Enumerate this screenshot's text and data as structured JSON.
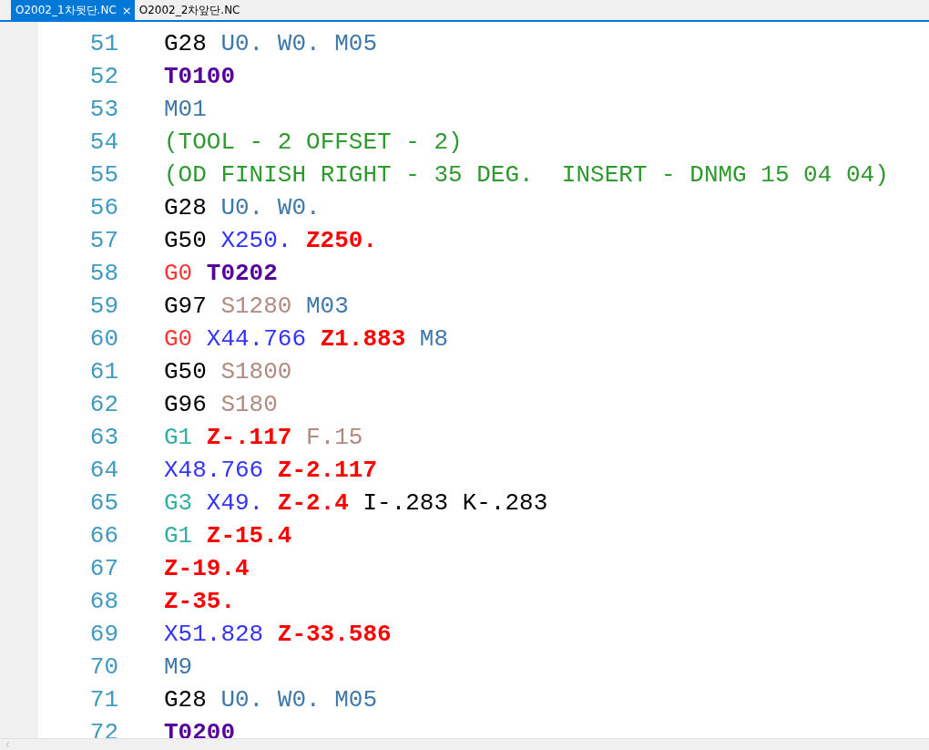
{
  "tabs": [
    {
      "label": "O2002_1차뒷단.NC",
      "selected": true,
      "close": "×"
    },
    {
      "label": "O2002_2차앞단.NC",
      "selected": false
    }
  ],
  "lines": [
    {
      "number": "51",
      "tokens": [
        {
          "kind": "g",
          "text": "G28"
        },
        {
          "kind": "m",
          "text": "U0."
        },
        {
          "kind": "m",
          "text": "W0."
        },
        {
          "kind": "m",
          "text": "M05"
        }
      ]
    },
    {
      "number": "52",
      "tokens": [
        {
          "kind": "t",
          "text": "T0100"
        }
      ]
    },
    {
      "number": "53",
      "tokens": [
        {
          "kind": "m",
          "text": "M01"
        }
      ]
    },
    {
      "number": "54",
      "tokens": [
        {
          "kind": "comment",
          "text": "(TOOL - 2 OFFSET - 2)"
        }
      ]
    },
    {
      "number": "55",
      "tokens": [
        {
          "kind": "comment",
          "text": "(OD FINISH RIGHT - 35 DEG.  INSERT - DNMG 15 04 04)"
        }
      ]
    },
    {
      "number": "56",
      "tokens": [
        {
          "kind": "g",
          "text": "G28"
        },
        {
          "kind": "m",
          "text": "U0."
        },
        {
          "kind": "m",
          "text": "W0."
        }
      ]
    },
    {
      "number": "57",
      "tokens": [
        {
          "kind": "g",
          "text": "G50"
        },
        {
          "kind": "x",
          "text": "X250."
        },
        {
          "kind": "z",
          "text": "Z250."
        }
      ]
    },
    {
      "number": "58",
      "tokens": [
        {
          "kind": "rapid",
          "text": "G0"
        },
        {
          "kind": "t",
          "text": "T0202"
        }
      ]
    },
    {
      "number": "59",
      "tokens": [
        {
          "kind": "g",
          "text": "G97"
        },
        {
          "kind": "s",
          "text": "S1280"
        },
        {
          "kind": "m",
          "text": "M03"
        }
      ]
    },
    {
      "number": "60",
      "tokens": [
        {
          "kind": "rapid",
          "text": "G0"
        },
        {
          "kind": "x",
          "text": "X44.766"
        },
        {
          "kind": "z",
          "text": "Z1.883"
        },
        {
          "kind": "m",
          "text": "M8"
        }
      ]
    },
    {
      "number": "61",
      "tokens": [
        {
          "kind": "g",
          "text": "G50"
        },
        {
          "kind": "s",
          "text": "S1800"
        }
      ]
    },
    {
      "number": "62",
      "tokens": [
        {
          "kind": "g",
          "text": "G96"
        },
        {
          "kind": "s",
          "text": "S180"
        }
      ]
    },
    {
      "number": "63",
      "tokens": [
        {
          "kind": "feed",
          "text": "G1"
        },
        {
          "kind": "z",
          "text": "Z-.117"
        },
        {
          "kind": "s",
          "text": "F.15"
        }
      ]
    },
    {
      "number": "64",
      "tokens": [
        {
          "kind": "x",
          "text": "X48.766"
        },
        {
          "kind": "z",
          "text": "Z-2.117"
        }
      ]
    },
    {
      "number": "65",
      "tokens": [
        {
          "kind": "feed",
          "text": "G3"
        },
        {
          "kind": "x",
          "text": "X49."
        },
        {
          "kind": "z",
          "text": "Z-2.4"
        },
        {
          "kind": "g",
          "text": "I-.283"
        },
        {
          "kind": "g",
          "text": "K-.283"
        }
      ]
    },
    {
      "number": "66",
      "tokens": [
        {
          "kind": "feed",
          "text": "G1"
        },
        {
          "kind": "z",
          "text": "Z-15.4"
        }
      ]
    },
    {
      "number": "67",
      "tokens": [
        {
          "kind": "z",
          "text": "Z-19.4"
        }
      ]
    },
    {
      "number": "68",
      "tokens": [
        {
          "kind": "z",
          "text": "Z-35."
        }
      ]
    },
    {
      "number": "69",
      "tokens": [
        {
          "kind": "x",
          "text": "X51.828"
        },
        {
          "kind": "z",
          "text": "Z-33.586"
        }
      ]
    },
    {
      "number": "70",
      "tokens": [
        {
          "kind": "m",
          "text": "M9"
        }
      ]
    },
    {
      "number": "71",
      "tokens": [
        {
          "kind": "g",
          "text": "G28"
        },
        {
          "kind": "m",
          "text": "U0."
        },
        {
          "kind": "m",
          "text": "W0."
        },
        {
          "kind": "m",
          "text": "M05"
        }
      ]
    },
    {
      "number": "72",
      "tokens": [
        {
          "kind": "t",
          "text": "T0200"
        }
      ]
    }
  ]
}
